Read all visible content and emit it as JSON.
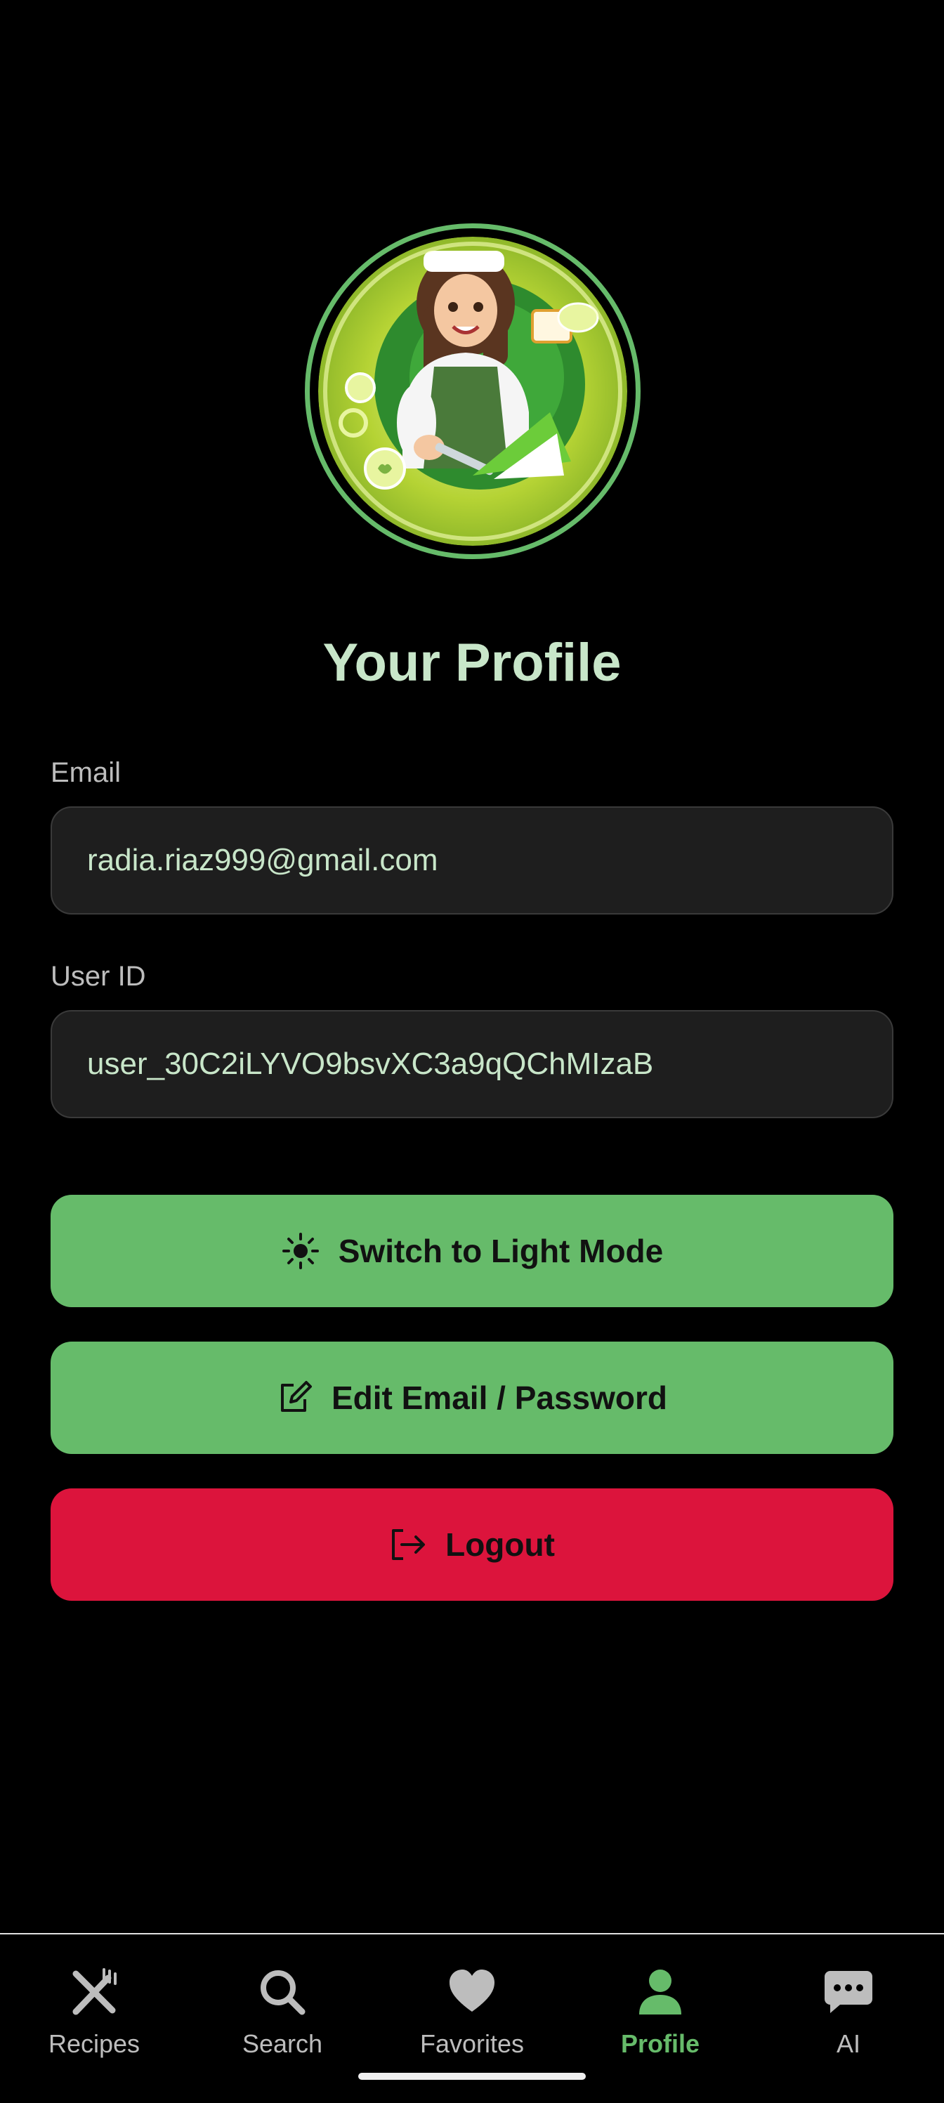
{
  "profile": {
    "title": "Your Profile",
    "email_label": "Email",
    "email_value": "radia.riaz999@gmail.com",
    "user_id_label": "User ID",
    "user_id_value": "user_30C2iLYVO9bsvXC3a9qQChMIzaB"
  },
  "actions": {
    "theme_label": "Switch to Light Mode",
    "edit_label": "Edit Email / Password",
    "logout_label": "Logout"
  },
  "nav": {
    "items": [
      {
        "label": "Recipes",
        "icon": "fork-knife-icon"
      },
      {
        "label": "Search",
        "icon": "search-icon"
      },
      {
        "label": "Favorites",
        "icon": "heart-icon"
      },
      {
        "label": "Profile",
        "icon": "person-icon",
        "active": true
      },
      {
        "label": "AI",
        "icon": "chat-icon"
      }
    ]
  },
  "colors": {
    "accent": "#66bb6a",
    "danger": "#dc143c",
    "title": "#c8e6c9",
    "field_bg": "#1e1e1e"
  }
}
